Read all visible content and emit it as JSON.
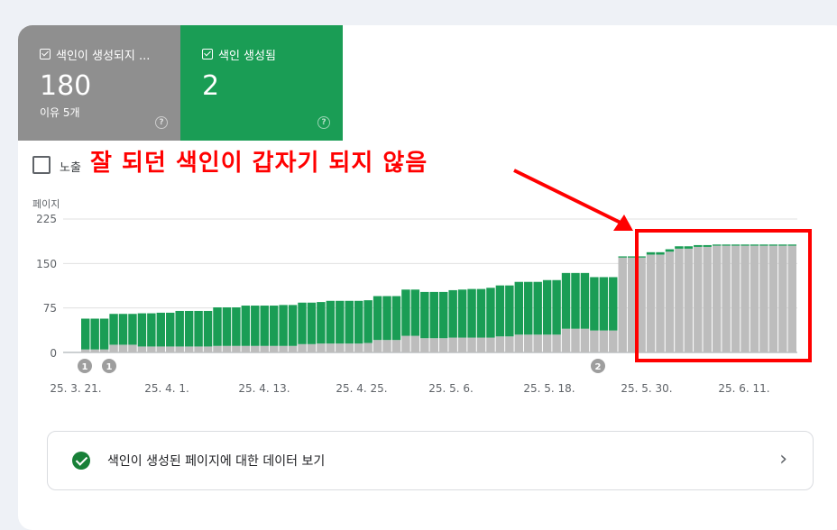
{
  "tiles": {
    "not_indexed": {
      "label": "색인이 생성되지 ...",
      "value": "180",
      "sub": "이유 5개",
      "help": "?"
    },
    "indexed": {
      "label": "색인 생성됨",
      "value": "2",
      "help": "?"
    }
  },
  "impressions_label": "노출",
  "annotation": "잘 되던 색인이 갑자기 되지 않음",
  "colors": {
    "indexed": "#1a9d55",
    "not_indexed": "#bdbdbd",
    "highlight": "#ff0000"
  },
  "bottom_link": {
    "text": "색인이 생성된 페이지에 대한 데이터 보기",
    "icon": "check-circle-icon",
    "chevron": "›"
  },
  "chart_data": {
    "type": "bar",
    "stacked": true,
    "ylabel": "페이지",
    "ylim": [
      0,
      225
    ],
    "yticks": [
      "225",
      "150",
      "75",
      "0"
    ],
    "xtick_labels": [
      "25. 3. 21.",
      "25. 4. 1.",
      "25. 4. 13.",
      "25. 4. 25.",
      "25. 5. 6.",
      "25. 5. 18.",
      "25. 5. 30.",
      "25. 6. 11."
    ],
    "markers": [
      "1",
      "1",
      "2"
    ],
    "series": [
      {
        "name": "색인이 생성되지 않음",
        "color": "#bdbdbd",
        "values": [
          5,
          5,
          5,
          13,
          13,
          13,
          10,
          10,
          10,
          10,
          10,
          10,
          10,
          10,
          11,
          11,
          11,
          11,
          11,
          11,
          11,
          11,
          11,
          14,
          14,
          15,
          15,
          15,
          15,
          15,
          16,
          21,
          21,
          21,
          28,
          28,
          24,
          24,
          24,
          25,
          25,
          25,
          25,
          25,
          27,
          27,
          30,
          30,
          30,
          30,
          30,
          40,
          40,
          40,
          37,
          37,
          37,
          160,
          160,
          160,
          165,
          165,
          170,
          175,
          175,
          178,
          178,
          180,
          180,
          180,
          180,
          180,
          180,
          180,
          180,
          180
        ]
      },
      {
        "name": "색인 생성됨",
        "color": "#1a9d55",
        "values": [
          52,
          52,
          52,
          52,
          52,
          52,
          56,
          56,
          57,
          57,
          60,
          60,
          60,
          60,
          65,
          65,
          65,
          68,
          68,
          68,
          68,
          69,
          69,
          70,
          70,
          70,
          72,
          72,
          72,
          72,
          72,
          74,
          74,
          74,
          78,
          78,
          78,
          78,
          78,
          80,
          81,
          82,
          82,
          84,
          86,
          86,
          89,
          89,
          89,
          92,
          92,
          94,
          94,
          94,
          90,
          90,
          90,
          2,
          2,
          2,
          4,
          4,
          4,
          4,
          4,
          3,
          3,
          2,
          2,
          2,
          2,
          2,
          2,
          2,
          2,
          2
        ]
      }
    ]
  }
}
